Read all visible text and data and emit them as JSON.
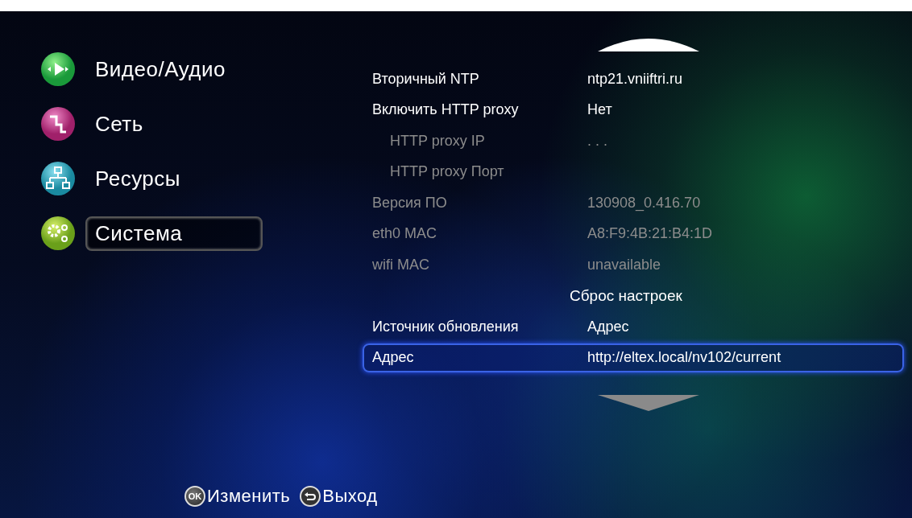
{
  "menu": [
    {
      "label": "Видео/Аудио",
      "selected": false
    },
    {
      "label": "Сеть",
      "selected": false
    },
    {
      "label": "Ресурсы",
      "selected": false
    },
    {
      "label": "Система",
      "selected": true
    }
  ],
  "settings": [
    {
      "kind": "field",
      "label": "Вторичный NTP",
      "value": "ntp21.vniiftri.ru",
      "disabled": false,
      "selected": false
    },
    {
      "kind": "field",
      "label": "Включить HTTP proxy",
      "value": "Нет",
      "disabled": false,
      "selected": false,
      "children": [
        {
          "kind": "field",
          "label": "HTTP proxy IP",
          "value": ". . .",
          "disabled": true,
          "selected": false
        },
        {
          "kind": "field",
          "label": "HTTP proxy Порт",
          "disabled": true,
          "selected": false
        }
      ]
    },
    {
      "kind": "field",
      "label": "Версия ПО",
      "value": "130908_0.416.70",
      "disabled": true,
      "selected": false
    },
    {
      "kind": "field",
      "label": "eth0 MAC",
      "value": "A8:F9:4B:21:B4:1D",
      "disabled": true,
      "selected": false
    },
    {
      "kind": "field",
      "label": "wifi MAC",
      "value": "unavailable",
      "disabled": true,
      "selected": false
    },
    {
      "kind": "action",
      "label": "Сброс настроек",
      "disabled": false,
      "selected": false
    },
    {
      "kind": "field",
      "label": "Источник обновления",
      "value": "Адрес",
      "disabled": false,
      "selected": false
    },
    {
      "kind": "field",
      "label": "Адрес",
      "value": "http://eltex.local/nv102/current",
      "disabled": false,
      "selected": true
    }
  ],
  "hints": [
    {
      "kind": "key",
      "key": "OK",
      "label": "Изменить"
    },
    {
      "kind": "back",
      "label": "Выход"
    }
  ]
}
